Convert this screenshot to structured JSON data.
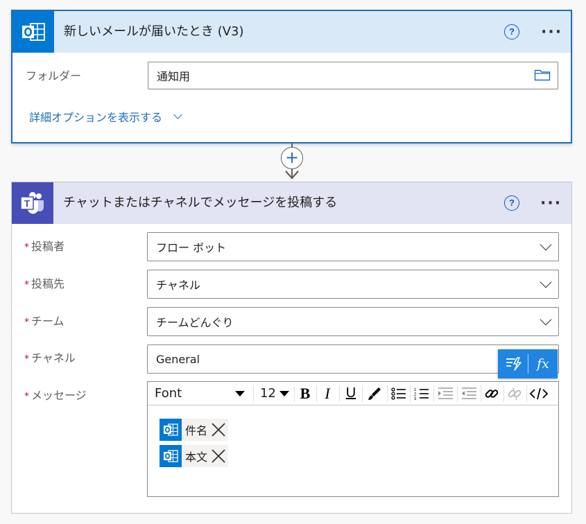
{
  "trigger": {
    "title": "新しいメールが届いたとき (V3)",
    "help": "?",
    "more": "···",
    "folder_label": "フォルダー",
    "folder_value": "通知用",
    "advanced_link": "詳細オプションを表示する"
  },
  "connector": {
    "plus": "+"
  },
  "action": {
    "title": "チャットまたはチャネルでメッセージを投稿する",
    "help": "?",
    "more": "···",
    "required_mark": "*",
    "fields": [
      {
        "label": "投稿者",
        "value": "フロー ボット"
      },
      {
        "label": "投稿先",
        "value": "チャネル"
      },
      {
        "label": "チーム",
        "value": "チームどんぐり"
      },
      {
        "label": "チャネル",
        "value": "General"
      },
      {
        "label": "メッセージ",
        "value": ""
      }
    ],
    "dynamic_content_fx": "fx",
    "editor": {
      "font_value": "Font",
      "size_value": "12",
      "bold": "B",
      "italic": "I",
      "underline": "U",
      "tokens": [
        {
          "label": "件名"
        },
        {
          "label": "本文"
        }
      ]
    }
  },
  "colors": {
    "outlook_blue": "#0078d4",
    "teams_purple": "#464eb8",
    "trigger_header": "#dae9f8",
    "action_header": "#e2e3f3",
    "link_blue": "#1f6fb5",
    "required_red": "#a4262c"
  },
  "icons": [
    "outlook-icon",
    "teams-icon",
    "help-icon",
    "more-icon",
    "folder-icon",
    "chevron-down-icon",
    "add-icon",
    "arrow-down-icon",
    "dynamic-content-icon",
    "expression-icon",
    "paint-brush-icon",
    "bullet-list-icon",
    "numbered-list-icon",
    "indent-icon",
    "outdent-icon",
    "link-icon",
    "unlink-icon",
    "code-view-icon",
    "remove-token-icon"
  ]
}
